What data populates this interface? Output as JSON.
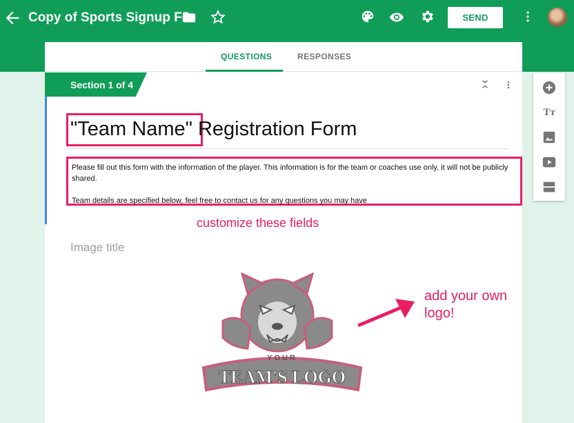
{
  "appbar": {
    "title": "Copy of Sports Signup For",
    "send_label": "SEND",
    "icons": [
      "back-arrow-icon",
      "folder-icon",
      "star-icon",
      "palette-icon",
      "preview-eye-icon",
      "settings-gear-icon",
      "more-vert-icon",
      "avatar"
    ]
  },
  "tabs": [
    {
      "label": "QUESTIONS",
      "active": true
    },
    {
      "label": "RESPONSES",
      "active": false
    }
  ],
  "section": {
    "label": "Section 1 of 4"
  },
  "form": {
    "title_highlight": "\"Team Name\"",
    "title_rest": " Registration Form",
    "description_line1": "Please fill out this form with the information of the player. This information is for the team or coaches use only, it will not be publicly shared.",
    "description_line2": "Team details are specified below, feel free to contact us for any questions you may have"
  },
  "annotations": {
    "customize": "customize these fields",
    "logo_line1": "add your own",
    "logo_line2": "logo!"
  },
  "image_block": {
    "title_placeholder": "Image title",
    "logo_text_small": "YOUR",
    "logo_text_big": "TEAM'S LOGO"
  },
  "toolbar": {
    "items": [
      "add-question-icon",
      "add-title-icon",
      "add-image-icon",
      "add-video-icon",
      "add-section-icon"
    ],
    "title_icon_text": "Tт"
  },
  "colors": {
    "brand": "#0f9d58",
    "accent_annotation": "#e91e63",
    "background": "#e0f2e9"
  }
}
